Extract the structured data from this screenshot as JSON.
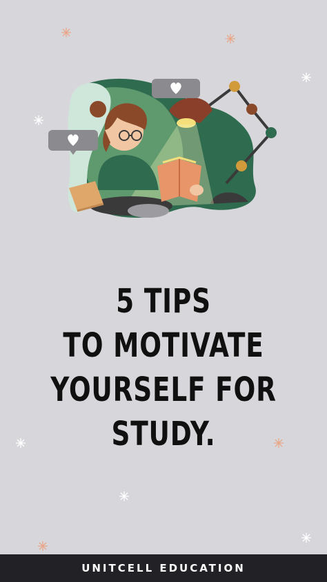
{
  "title": {
    "line1": "5 TIPS",
    "line2": "TO MOTIVATE",
    "line3": "YOURSELF FOR",
    "line4": "STUDY."
  },
  "footer": {
    "brand": "UNITCELL EDUCATION"
  },
  "colors": {
    "background": "#d7d6da",
    "footer": "#222226",
    "accent_green": "#2f6b4f",
    "accent_orange": "#e9956a",
    "text": "#101010"
  },
  "icons": [
    "sparkle-icon",
    "heart-icon",
    "desk-lamp-icon",
    "open-book-icon"
  ]
}
